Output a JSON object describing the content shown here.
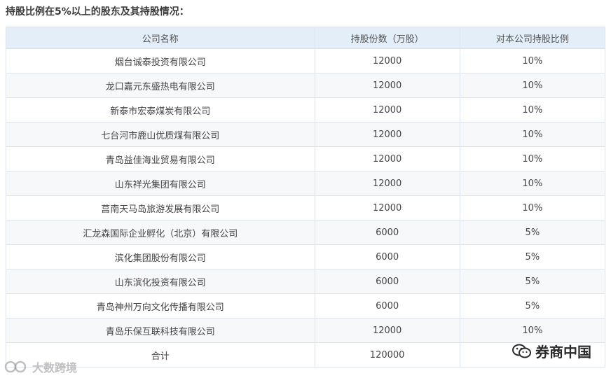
{
  "title": "持股比例在5%以上的股东及其持股情况：",
  "table": {
    "headers": [
      "公司名称",
      "持股份数（万股）",
      "对本公司持股比例"
    ],
    "rows": [
      [
        "烟台诚泰投资有限公司",
        "12000",
        "10%"
      ],
      [
        "龙口嘉元东盛热电有限公司",
        "12000",
        "10%"
      ],
      [
        "新泰市宏泰煤炭有限公司",
        "12000",
        "10%"
      ],
      [
        "七台河市鹿山优质煤有限公司",
        "12000",
        "10%"
      ],
      [
        "青岛益佳海业贸易有限公司",
        "12000",
        "10%"
      ],
      [
        "山东祥光集团有限公司",
        "12000",
        "10%"
      ],
      [
        "莒南天马岛旅游发展有限公司",
        "12000",
        "10%"
      ],
      [
        "汇龙森国际企业孵化（北京）有限公司",
        "6000",
        "5%"
      ],
      [
        "滨化集团股份有限公司",
        "6000",
        "5%"
      ],
      [
        "山东滨化投资有限公司",
        "6000",
        "5%"
      ],
      [
        "青岛神州万向文化传播有限公司",
        "6000",
        "5%"
      ],
      [
        "青岛乐保互联科技有限公司",
        "12000",
        "10%"
      ],
      [
        "合计",
        "120000",
        ""
      ]
    ]
  },
  "logo": {
    "text": "券商中国",
    "icon": "wechat-icon"
  },
  "watermark": {
    "text": "大数跨境",
    "icon": "watermark-logo-icon"
  }
}
